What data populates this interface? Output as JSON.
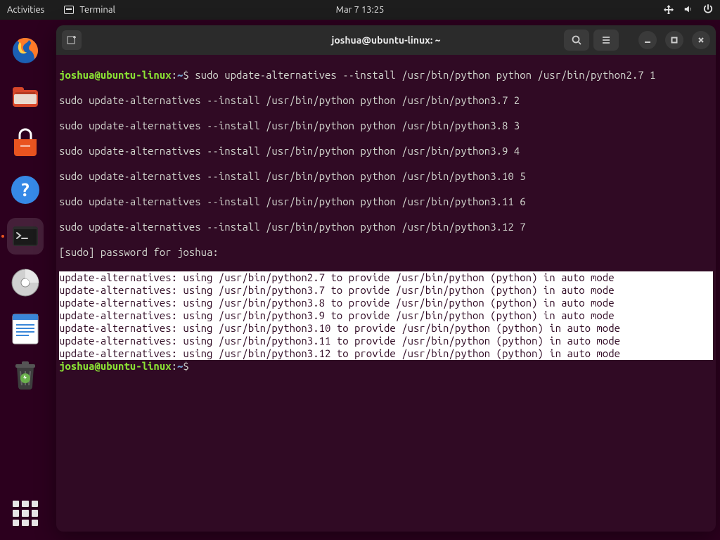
{
  "topbar": {
    "activities": "Activities",
    "appname": "Terminal",
    "datetime": "Mar 7  13:25"
  },
  "dock": {
    "items": [
      "firefox",
      "files",
      "software",
      "help",
      "terminal",
      "disks",
      "text-editor",
      "trash"
    ]
  },
  "window": {
    "title": "joshua@ubuntu-linux: ~"
  },
  "prompt": {
    "user": "joshua@ubuntu-linux",
    "path": "~",
    "sep": ":",
    "sym": "$"
  },
  "cmd": {
    "l1": " sudo update-alternatives --install /usr/bin/python python /usr/bin/python2.7 1",
    "l2": "sudo update-alternatives --install /usr/bin/python python /usr/bin/python3.7 2",
    "l3": "sudo update-alternatives --install /usr/bin/python python /usr/bin/python3.8 3",
    "l4": "sudo update-alternatives --install /usr/bin/python python /usr/bin/python3.9 4",
    "l5": "sudo update-alternatives --install /usr/bin/python python /usr/bin/python3.10 5",
    "l6": "sudo update-alternatives --install /usr/bin/python python /usr/bin/python3.11 6",
    "l7": "sudo update-alternatives --install /usr/bin/python python /usr/bin/python3.12 7",
    "pw": "[sudo] password for joshua: "
  },
  "out": {
    "o1": "update-alternatives: using /usr/bin/python2.7 to provide /usr/bin/python (python) in auto mode",
    "o2": "update-alternatives: using /usr/bin/python3.7 to provide /usr/bin/python (python) in auto mode",
    "o3": "update-alternatives: using /usr/bin/python3.8 to provide /usr/bin/python (python) in auto mode",
    "o4": "update-alternatives: using /usr/bin/python3.9 to provide /usr/bin/python (python) in auto mode",
    "o5": "update-alternatives: using /usr/bin/python3.10 to provide /usr/bin/python (python) in auto mode",
    "o6": "update-alternatives: using /usr/bin/python3.11 to provide /usr/bin/python (python) in auto mode",
    "o7": "update-alternatives: using /usr/bin/python3.12 to provide /usr/bin/python (python) in auto mode"
  }
}
